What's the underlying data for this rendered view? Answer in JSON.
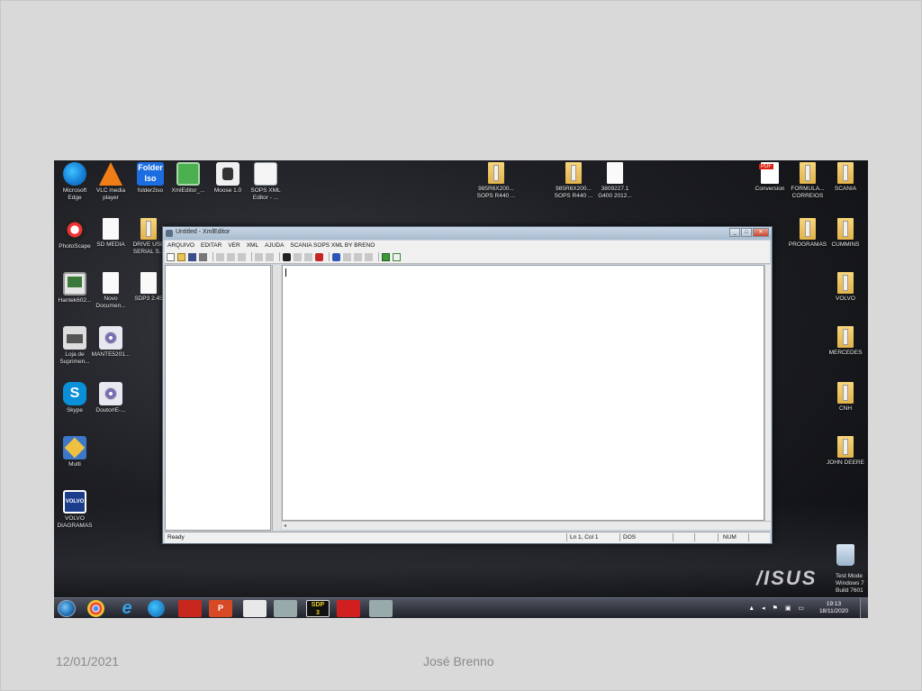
{
  "footer": {
    "date": "12/01/2021",
    "author": "José Brenno"
  },
  "desktop": {
    "icons": [
      {
        "label": "Microsoft\nEdge",
        "icon": "edge-icon"
      },
      {
        "label": "VLC media\nplayer",
        "icon": "vlc-icon"
      },
      {
        "label": "folder2iso",
        "icon": "folder2iso-icon",
        "glyph_text": "Folder\nIso"
      },
      {
        "label": "XmlEditor_...",
        "icon": "xml-editor-icon"
      },
      {
        "label": "Moose 1.0",
        "icon": "moose-icon"
      },
      {
        "label": "SOPS XML\nEditor - ...",
        "icon": "sops-editor-icon"
      },
      {
        "label": "PhotoScape",
        "icon": "photoscape-icon"
      },
      {
        "label": "SD MEDIA",
        "icon": "document-icon"
      },
      {
        "label": "DRIVE USB\nSERIAL S...",
        "icon": "folder-icon"
      },
      {
        "label": "Hantek602...",
        "icon": "hantek-icon"
      },
      {
        "label": "Novo\nDocumen...",
        "icon": "document-icon"
      },
      {
        "label": "SDP3 2.45",
        "icon": "document-icon"
      },
      {
        "label": "Loja de\nSuprimen...",
        "icon": "printer-icon"
      },
      {
        "label": "MANTE5201...",
        "icon": "disc-image-icon"
      },
      {
        "label": "Skype",
        "icon": "skype-icon"
      },
      {
        "label": "DoutorIE-...",
        "icon": "disc-image-icon"
      },
      {
        "label": "Multi",
        "icon": "multi-icon"
      },
      {
        "label": "VOLVO\nDIAGRAMAS",
        "icon": "volvo-icon",
        "glyph_text": "VOLVO"
      },
      {
        "label": "985R6X200...\nSOPS R440 ...",
        "icon": "folder-icon"
      },
      {
        "label": "985R6X200...\nSOPS R440 ...",
        "icon": "folder-icon"
      },
      {
        "label": "3809227.1\nG400 2012...",
        "icon": "document-icon"
      },
      {
        "label": "Conversion",
        "icon": "pdf-icon"
      },
      {
        "label": "FORMULA...\nCORREIOS",
        "icon": "folder-icon"
      },
      {
        "label": "SCANIA",
        "icon": "folder-icon"
      },
      {
        "label": "PROGRAMAS",
        "icon": "folder-icon"
      },
      {
        "label": "CUMMINS",
        "icon": "folder-icon"
      },
      {
        "label": "VOLVO",
        "icon": "folder-icon"
      },
      {
        "label": "MERCEDES",
        "icon": "folder-icon"
      },
      {
        "label": "CNH",
        "icon": "folder-icon"
      },
      {
        "label": "JOHN DEERE",
        "icon": "folder-icon"
      },
      {
        "label": "",
        "icon": "recycle-bin-icon"
      }
    ],
    "brand_logo": "/ISUS",
    "windows_notice": "Test Mode\nWindows 7\nBuild 7601"
  },
  "app_window": {
    "title": "Untitled - XmlEditor",
    "menu": [
      "ARQUIVO",
      "EDITAR",
      "VER",
      "XML",
      "AJUDA",
      "SCANIA SOPS XML BY BRENO"
    ],
    "toolbar_icons": [
      "new-file-icon",
      "open-folder-icon",
      "save-icon",
      "print-icon",
      "cut-icon",
      "copy-icon",
      "paste-icon",
      "undo-icon",
      "redo-icon",
      "find-icon",
      "find-next-icon",
      "find-prev-icon",
      "replace-icon",
      "pen-icon",
      "bookmark-icon",
      "bookmark-next-icon",
      "bookmark-clear-icon",
      "validate-icon",
      "check-icon"
    ],
    "status": {
      "text": "Ready",
      "position": "Ln 1, Col 1",
      "encoding": "DOS",
      "num": "NUM"
    }
  },
  "taskbar": {
    "clock_time": "19:13",
    "clock_date": "18/11/2020",
    "sdp_label": "SDP\n3",
    "ppt_label": "P"
  }
}
